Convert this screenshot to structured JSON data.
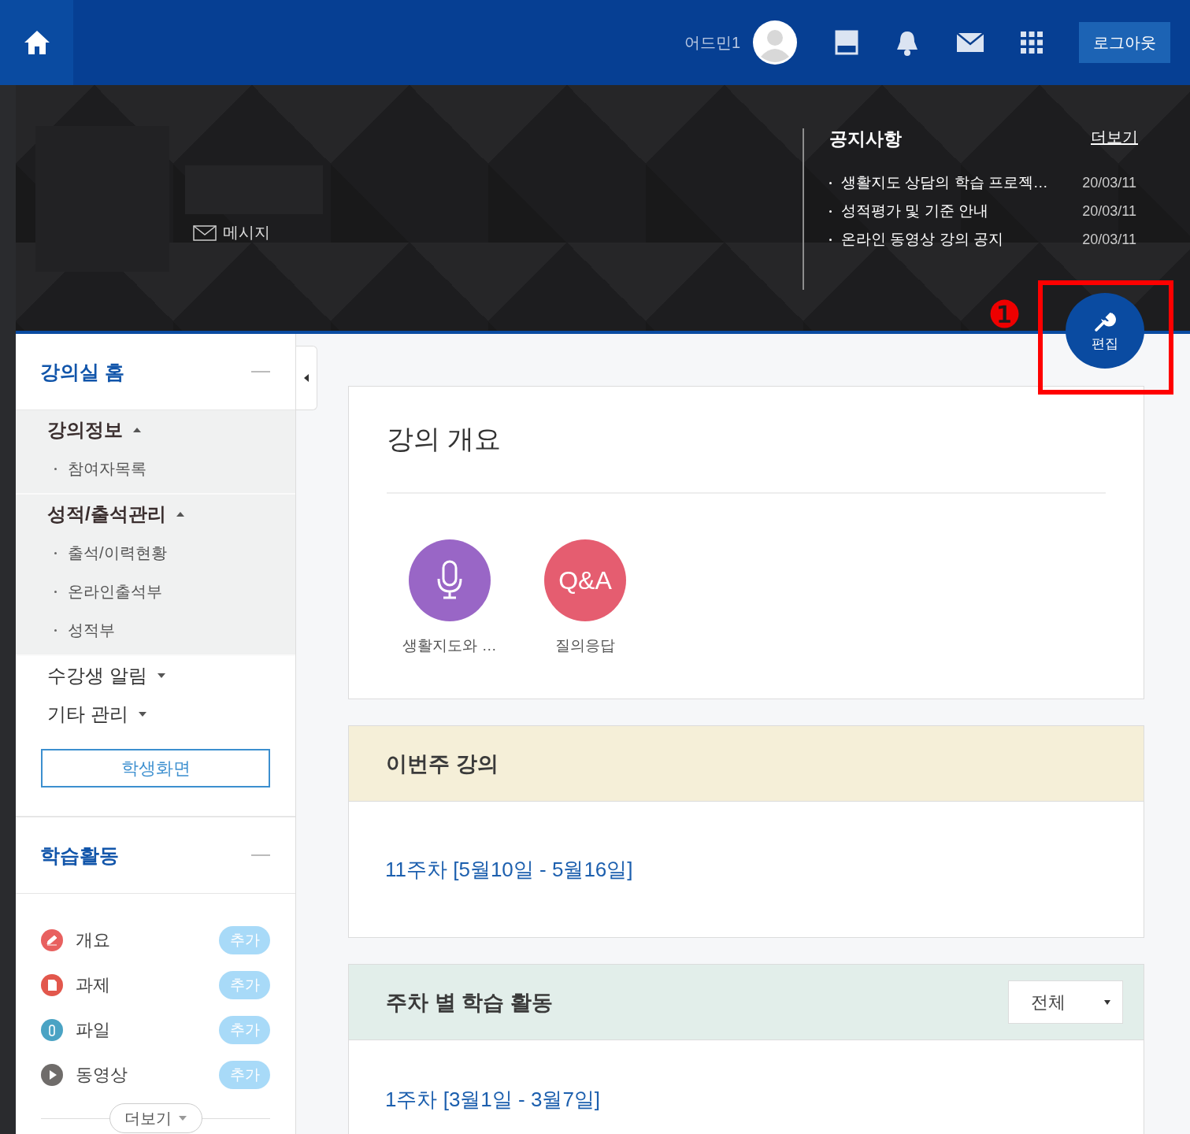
{
  "header": {
    "user_name": "어드민1",
    "logout": "로그아웃"
  },
  "banner": {
    "message_link": "메시지",
    "notices": {
      "title": "공지사항",
      "more": "더보기",
      "items": [
        {
          "title": "생활지도 상담의 학습 프로젝…",
          "date": "20/03/11"
        },
        {
          "title": "성적평가 및 기준 안내",
          "date": "20/03/11"
        },
        {
          "title": "온라인 동영상 강의 공지",
          "date": "20/03/11"
        }
      ]
    }
  },
  "edit_button": {
    "label": "편집"
  },
  "annotation": {
    "marker": "❶"
  },
  "sidebar": {
    "home_title": "강의실 홈",
    "menu": [
      {
        "label": "강의정보",
        "expanded": true,
        "children": [
          {
            "label": "참여자목록"
          }
        ]
      },
      {
        "label": "성적/출석관리",
        "expanded": true,
        "children": [
          {
            "label": "출석/이력현황"
          },
          {
            "label": "온라인출석부"
          },
          {
            "label": "성적부"
          }
        ]
      },
      {
        "label": "수강생 알림",
        "expanded": false
      },
      {
        "label": "기타 관리",
        "expanded": false
      }
    ],
    "student_view_button": "학생화면",
    "activities": {
      "title": "학습활동",
      "items": [
        {
          "label": "개요",
          "kind": "pencil",
          "color": "#e8605f",
          "action": "추가"
        },
        {
          "label": "과제",
          "kind": "document",
          "color": "#e2574c",
          "action": "추가"
        },
        {
          "label": "파일",
          "kind": "clip",
          "color": "#4aa3c4",
          "action": "추가"
        },
        {
          "label": "동영상",
          "kind": "play",
          "color": "#6f6c6a",
          "action": "추가"
        }
      ],
      "more": "더보기"
    }
  },
  "overview": {
    "title": "강의 개요",
    "modules": [
      {
        "label": "생활지도와 …",
        "kind": "mic",
        "color": "#9966c6"
      },
      {
        "label": "질의응답",
        "kind": "text",
        "color": "#e55d70",
        "icon_text": "Q&A"
      }
    ]
  },
  "this_week": {
    "title": "이번주 강의",
    "link": "11주차 [5월10일 - 5월16일]"
  },
  "weekly": {
    "title": "주차 별 학습 활동",
    "filter": "전체",
    "weeks": [
      {
        "link": "1주차 [3월1일 - 3월7일]"
      }
    ]
  }
}
